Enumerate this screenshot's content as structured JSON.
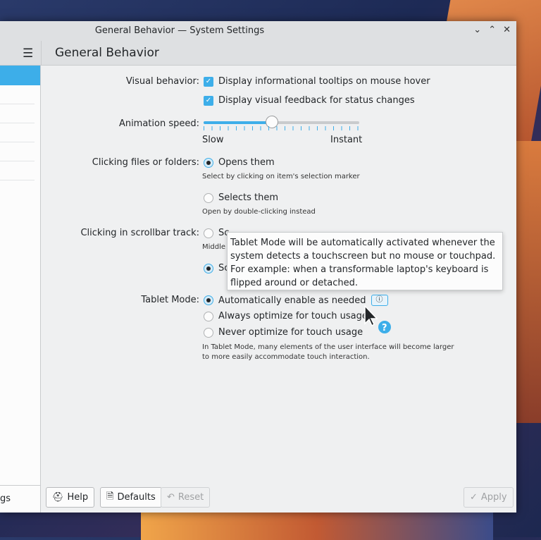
{
  "window": {
    "title": "General Behavior — System Settings",
    "minimize": "⌄",
    "maximize": "⌃",
    "close": "✕"
  },
  "header": {
    "menu_icon": "☰",
    "title": "General Behavior"
  },
  "sidebar": {
    "footer_text": "gs"
  },
  "visual": {
    "label": "Visual behavior:",
    "opt1": "Display informational tooltips on mouse hover",
    "opt2": "Display visual feedback for status changes"
  },
  "animation": {
    "label": "Animation speed:",
    "min": "Slow",
    "max": "Instant",
    "value_fraction": 0.44
  },
  "clicking": {
    "label": "Clicking files or folders:",
    "opt1": "Opens them",
    "hint1": "Select by clicking on item's selection marker",
    "opt2": "Selects them",
    "hint2": "Open by double-clicking instead"
  },
  "scrollbar": {
    "label": "Clicking in scrollbar track:",
    "opt1": "Sc",
    "hint1": "Middle",
    "opt2": "Sc"
  },
  "tablet": {
    "label": "Tablet Mode:",
    "opt1": "Automatically enable as needed",
    "opt2": "Always optimize for touch usage",
    "opt3": "Never optimize for touch usage",
    "hint": "In Tablet Mode, many elements of the user interface will become larger to more easily accommodate touch interaction.",
    "info_icon": "ⓘ"
  },
  "tooltip": {
    "text": "Tablet Mode will be automatically activated whenever the system detects a touchscreen but no mouse or touchpad. For example: when a transformable laptop's keyboard is flipped around or detached."
  },
  "footer": {
    "help": "Help",
    "defaults": "Defaults",
    "reset": "Reset",
    "apply": "Apply"
  }
}
